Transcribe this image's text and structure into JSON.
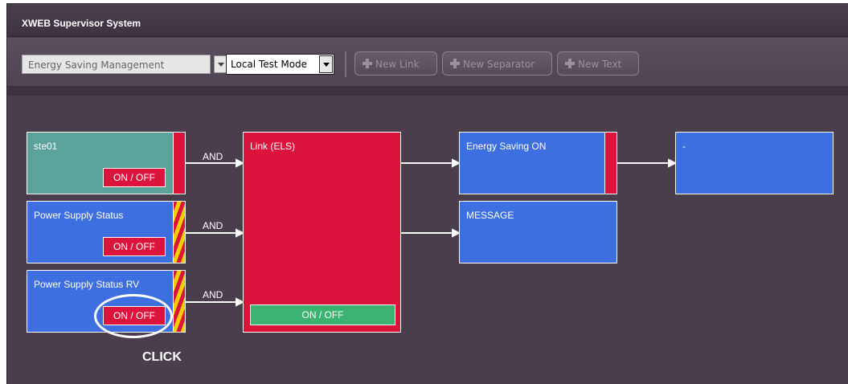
{
  "window": {
    "title": "XWEB Supervisor System"
  },
  "toolbar": {
    "energy_select": {
      "value": "Energy Saving Management"
    },
    "mode_select": {
      "value": "Local Test Mode"
    },
    "new_link_label": "New Link",
    "new_separator_label": "New Separator",
    "new_text_label": "New Text"
  },
  "nodes": {
    "ste01": {
      "name": "ste01",
      "button": "ON / OFF"
    },
    "power_supply_status": {
      "name": "Power Supply Status",
      "button": "ON / OFF"
    },
    "power_supply_status_rv": {
      "name": "Power Supply Status RV",
      "button": "ON / OFF"
    },
    "link_els": {
      "name": "Link (ELS)",
      "button": "ON / OFF"
    },
    "energy_saving_on": {
      "name": "Energy Saving ON"
    },
    "message": {
      "name": "MESSAGE"
    },
    "dash": {
      "name": "-"
    }
  },
  "gates": [
    "AND",
    "AND",
    "AND"
  ],
  "annotation": {
    "click": "CLICK"
  }
}
